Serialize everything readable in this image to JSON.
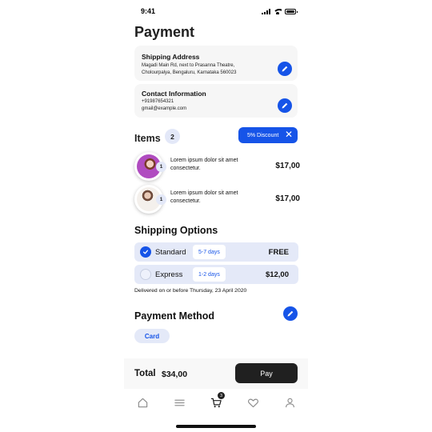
{
  "status_bar": {
    "time": "9:41"
  },
  "page": {
    "title": "Payment"
  },
  "shipping_address": {
    "heading": "Shipping Address",
    "line1": "Magadi Main Rd, next to Prasanna Theatre,",
    "line2": "Cholourpalya, Bengaluru, Karnataka 560023"
  },
  "contact": {
    "heading": "Contact Information",
    "phone": "+91987654321",
    "email": "gmail@example.com"
  },
  "items": {
    "heading": "Items",
    "count": "2",
    "discount_label": "5% Discount",
    "list": [
      {
        "qty": "1",
        "description": "Lorem ipsum dolor sit amet consectetur.",
        "price": "$17,00"
      },
      {
        "qty": "1",
        "description": "Lorem ipsum dolor sit amet consectetur.",
        "price": "$17,00"
      }
    ]
  },
  "shipping_options": {
    "heading": "Shipping Options",
    "options": [
      {
        "name": "Standard",
        "days": "5-7 days",
        "cost": "FREE",
        "selected": true
      },
      {
        "name": "Express",
        "days": "1-2 days",
        "cost": "$12,00",
        "selected": false
      }
    ],
    "delivery_note": "Delivered on or before Thursday, 23 April 2020"
  },
  "payment_method": {
    "heading": "Payment Method",
    "selected": "Card"
  },
  "footer": {
    "total_label": "Total",
    "total_amount": "$34,00",
    "pay_label": "Pay"
  },
  "nav": {
    "cart_count": "3",
    "tabs": [
      "home-icon",
      "menu-icon",
      "cart-icon",
      "heart-icon",
      "profile-icon"
    ]
  },
  "colors": {
    "accent": "#1654e8",
    "card_bg": "#f6f6f6",
    "option_bg": "#e4e9f8",
    "pay_button": "#202020"
  }
}
